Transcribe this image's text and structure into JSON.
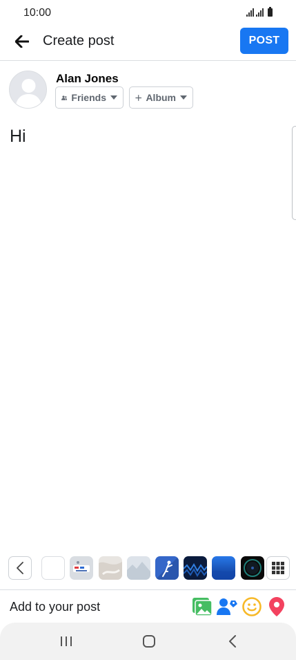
{
  "status_bar": {
    "time": "10:00"
  },
  "header": {
    "title": "Create post",
    "post_label": "POST"
  },
  "composer": {
    "user_name": "Alan Jones",
    "audience_label": "Friends",
    "album_label": "Album",
    "post_text": "Hi"
  },
  "background_strip": {
    "swatches": [
      {
        "name": "plain-white",
        "colors": [
          "#ffffff",
          "#ffffff"
        ]
      },
      {
        "name": "illustration-gray",
        "colors": [
          "#d9dde2",
          "#c5cad1"
        ]
      },
      {
        "name": "marble",
        "colors": [
          "#eceae7",
          "#d7d2cc"
        ]
      },
      {
        "name": "misty",
        "colors": [
          "#dde3ea",
          "#c2ccd6"
        ]
      },
      {
        "name": "blue-figure",
        "colors": [
          "#3a6fd0",
          "#2450a8"
        ]
      },
      {
        "name": "dark-wave",
        "colors": [
          "#0a1b3d",
          "#123a7a"
        ]
      },
      {
        "name": "blue-gradient",
        "colors": [
          "#1e64d6",
          "#0f3c9c"
        ]
      },
      {
        "name": "black-ring",
        "colors": [
          "#0a0a0a",
          "#1a2a2a"
        ]
      }
    ]
  },
  "add_to_post": {
    "label": "Add to your post",
    "icons": [
      "photo-icon",
      "tag-people-icon",
      "feeling-icon",
      "location-icon"
    ]
  },
  "colors": {
    "accent": "#1877f2",
    "photo": "#45bd62",
    "feeling": "#f7b928",
    "location": "#f3425f"
  }
}
